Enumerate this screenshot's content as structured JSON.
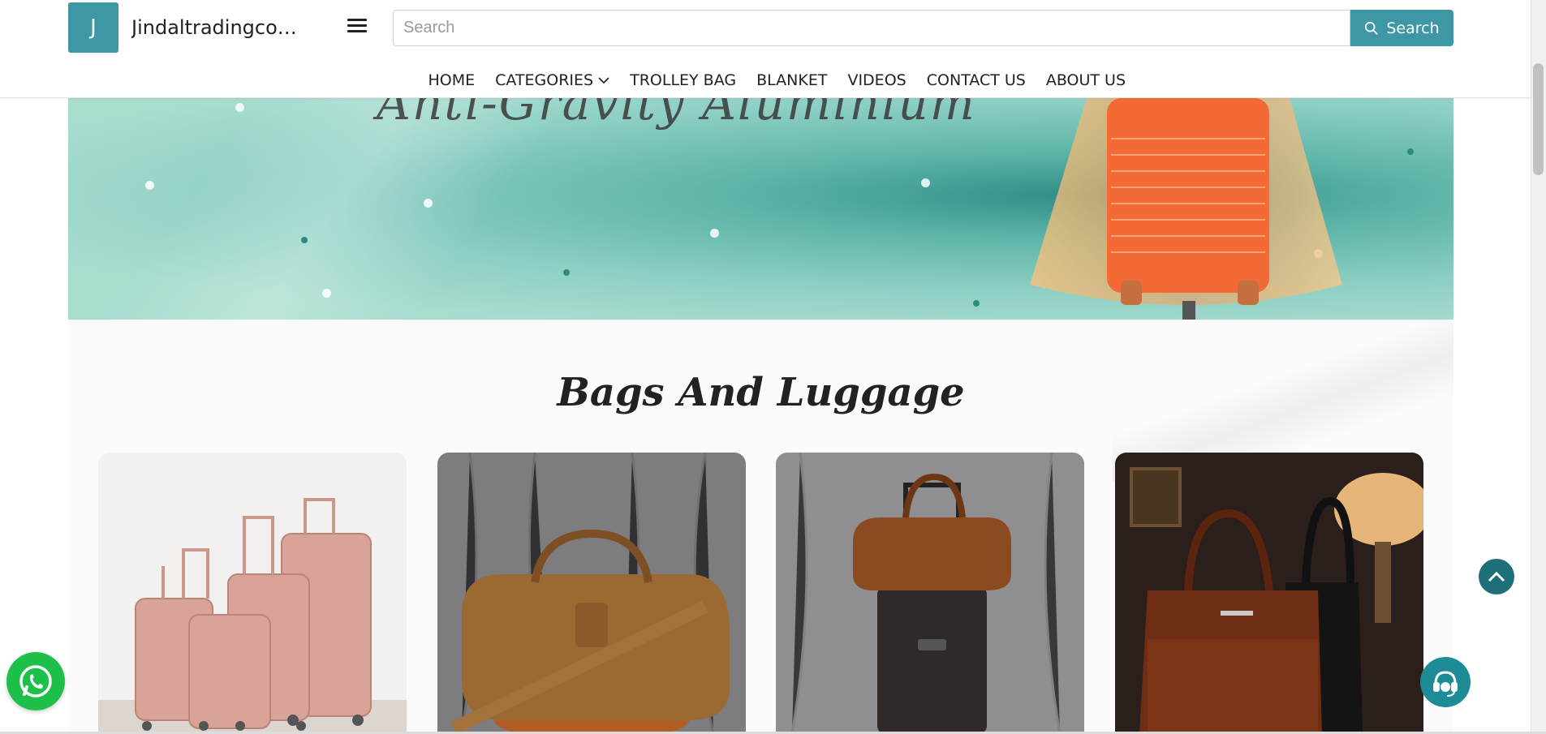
{
  "header": {
    "logo_letter": "J",
    "site_name": "Jindaltradingcom...",
    "search_placeholder": "Search",
    "search_button_label": "Search"
  },
  "nav": {
    "items": [
      {
        "label": "HOME"
      },
      {
        "label": "CATEGORIES",
        "has_dropdown": true
      },
      {
        "label": "TROLLEY BAG"
      },
      {
        "label": "BLANKET"
      },
      {
        "label": "VIDEOS"
      },
      {
        "label": "CONTACT US"
      },
      {
        "label": "ABOUT US"
      }
    ]
  },
  "banner": {
    "script_text": "Anti-Gravity Aluminium"
  },
  "section": {
    "title": "Bags And Luggage",
    "products": [
      {
        "name": "rose-gold-trolley-set"
      },
      {
        "name": "leather-duffel-bag"
      },
      {
        "name": "duffel-on-trolley"
      },
      {
        "name": "leather-briefcases"
      }
    ]
  },
  "colors": {
    "accent": "#3e97a5",
    "whatsapp": "#1dc14a",
    "support": "#1d8c96",
    "scroll_top": "#1f6f7b",
    "banner": "#98d3c7"
  },
  "icons": {
    "menu": "hamburger-icon",
    "search": "search-icon",
    "dropdown": "chevron-down-icon",
    "whatsapp": "whatsapp-icon",
    "support": "headset-icon",
    "scroll_top": "chevron-up-icon"
  }
}
